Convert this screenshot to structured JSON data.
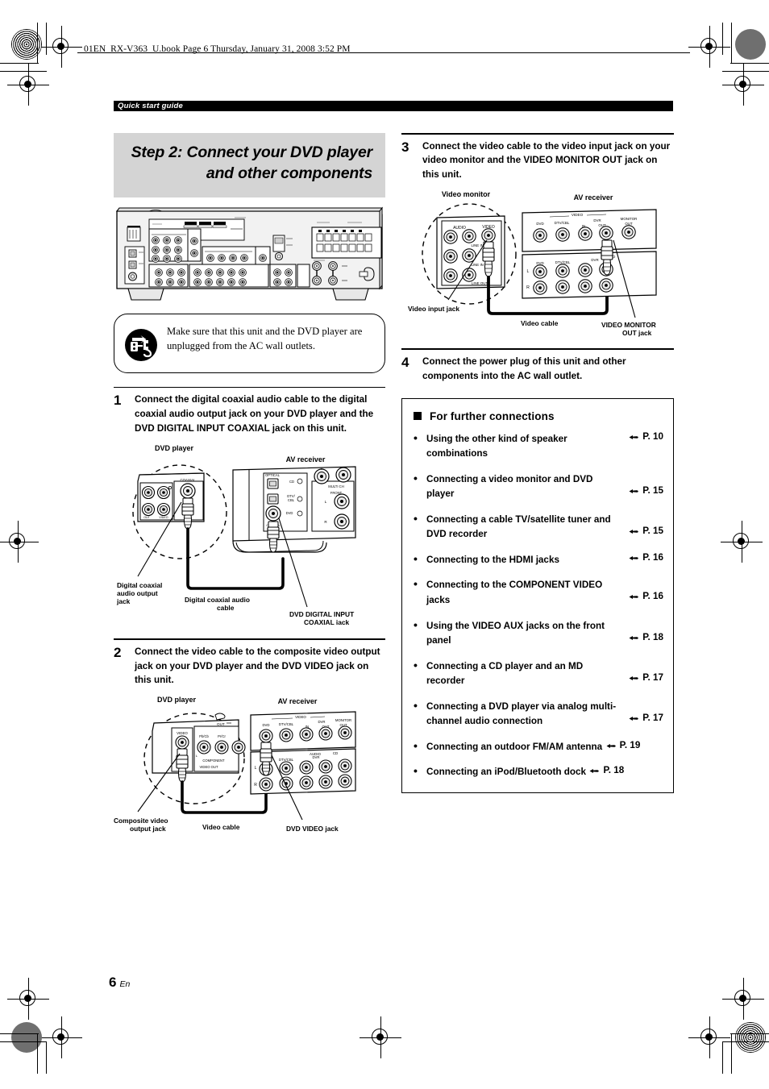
{
  "page": {
    "header_text": "01EN_RX-V363_U.book  Page 6  Thursday, January 31, 2008  3:52 PM",
    "kicker": "Quick start guide",
    "folio_number": "6",
    "folio_lang": "En"
  },
  "step_title": {
    "line1": "Step 2: Connect your DVD player",
    "line2": "and other components"
  },
  "caution": {
    "icon": "unplug-power-icon",
    "text": "Make sure that this unit and the DVD player are unplugged from the AC wall outlets."
  },
  "steps": [
    {
      "number": "1",
      "text": "Connect the digital coaxial audio cable to the digital coaxial audio output jack on your DVD player and the DVD DIGITAL INPUT COAXIAL jack on this unit.",
      "figure": {
        "name": "digital-coaxial-connection-figure",
        "labels": {
          "source": "DVD player",
          "target": "AV receiver",
          "source_jack": "Digital coaxial\naudio output\njack",
          "cable": "Digital coaxial audio\ncable",
          "target_jack": "DVD DIGITAL INPUT\nCOAXIAL jack"
        },
        "jack_marks": [
          "COAXIAL",
          "OPTICAL",
          "DTV/CBL",
          "DVD",
          "MULTI CH",
          "FRONT",
          "Y"
        ]
      }
    },
    {
      "number": "2",
      "text": "Connect the video cable to the composite video output jack on your DVD player and the DVD VIDEO jack on this unit.",
      "figure": {
        "name": "composite-video-connection-figure",
        "labels": {
          "source": "DVD player",
          "target": "AV receiver",
          "source_jack": "Composite video\noutput jack",
          "cable": "Video cable",
          "target_jack": "DVD VIDEO jack"
        },
        "jack_marks": [
          "VIDEO",
          "Pb/Cb",
          "Pr/Cr",
          "COMPONENT",
          "VIDEO OUT",
          "DVD",
          "DTV/CBL",
          "IN",
          "OUT",
          "DVR",
          "MONITOR OUT",
          "AUDIO",
          "CD",
          "L",
          "R"
        ]
      }
    },
    {
      "number": "3",
      "text": "Connect the video cable to the video input jack on your video monitor and the VIDEO MONITOR OUT jack on this unit.",
      "figure": {
        "name": "video-monitor-connection-figure",
        "labels": {
          "source": "Video monitor",
          "target": "AV receiver",
          "source_jack": "Video input jack",
          "cable": "Video cable",
          "target_jack": "VIDEO MONITOR\nOUT jack"
        },
        "jack_marks": [
          "AUDIO",
          "VIDEO",
          "LINE IN 1",
          "LINE IN 2",
          "LINE OUT",
          "DVD",
          "DTV/CBL",
          "IN",
          "OUT",
          "DVR",
          "MONITOR OUT"
        ]
      }
    },
    {
      "number": "4",
      "text": "Connect the power plug of this unit and other components into the AC wall outlet.",
      "figure": null
    }
  ],
  "further_connections": {
    "heading": "For further connections",
    "items": [
      {
        "text": "Using the other kind of speaker combinations",
        "page": "P. 10",
        "ref_on_own_line": false
      },
      {
        "text": "Connecting a video monitor and DVD player",
        "page": "P. 15",
        "ref_on_own_line": false
      },
      {
        "text": "Connecting a cable TV/satellite tuner and DVD recorder",
        "page": "P. 15",
        "ref_on_own_line": false
      },
      {
        "text": "Connecting to the HDMI jacks",
        "page": "P. 16",
        "ref_on_own_line": false
      },
      {
        "text": "Connecting to the COMPONENT VIDEO jacks",
        "page": "P. 16",
        "ref_on_own_line": false
      },
      {
        "text": "Using the VIDEO AUX jacks on the front panel",
        "page": "P. 18",
        "ref_on_own_line": false
      },
      {
        "text": "Connecting a CD player and an MD recorder",
        "page": "P. 17",
        "ref_on_own_line": false
      },
      {
        "text": "Connecting a DVD player via analog multi-channel audio connection",
        "page": "P. 17",
        "ref_on_own_line": false
      },
      {
        "text": "Connecting an outdoor FM/AM antenna",
        "page": "P. 19",
        "ref_on_own_line": true
      },
      {
        "text": "Connecting an iPod/Bluetooth dock",
        "page": "P. 18",
        "ref_on_own_line": true
      }
    ]
  },
  "receiver_figure": {
    "name": "rear-panel-artwork",
    "description": "Rear panel of the AV receiver showing antenna, digital, video, audio and speaker terminals"
  },
  "colors": {
    "title_block_bg": "#d4d4d4",
    "kicker_bg": "#000000",
    "kicker_text": "#ffffff",
    "page_bg": "#ffffff",
    "ink": "#000000"
  }
}
